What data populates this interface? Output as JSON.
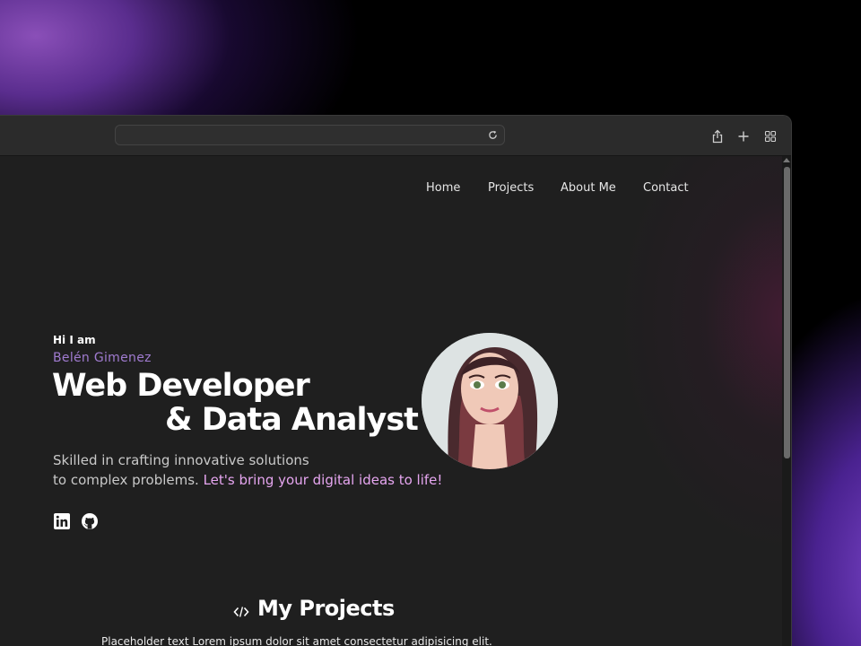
{
  "nav": {
    "items": [
      "Home",
      "Projects",
      "About Me",
      "Contact"
    ]
  },
  "hero": {
    "greeting": "Hi I am",
    "name": "Belén Gimenez",
    "title_line1": "Web Developer",
    "title_line2": "& Data Analyst",
    "description_line1": "Skilled in crafting innovative solutions",
    "description_line2": "to complex problems. ",
    "description_highlight": "Let's bring your digital ideas to life!",
    "accent_color": "#a07bd0",
    "highlight_color": "#e6a6f0"
  },
  "social": {
    "icons": [
      "linkedin-icon",
      "github-icon"
    ]
  },
  "projects": {
    "icon": "code-icon",
    "title": "My Projects",
    "intro": "Placeholder text Lorem ipsum dolor sit amet consectetur adipisicing elit."
  },
  "browser": {
    "toolbar_icons": [
      "reload-icon",
      "share-icon",
      "new-tab-icon",
      "tab-overview-icon"
    ]
  }
}
